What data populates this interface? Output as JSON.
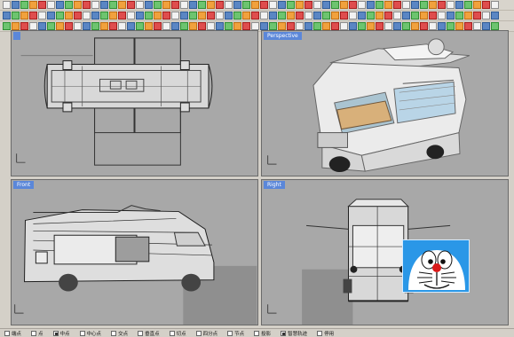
{
  "viewports": {
    "top_left_label": "",
    "perspective_label": "Perspective",
    "front_label": "Front",
    "right_label": "Right"
  },
  "status": {
    "items": [
      {
        "label": "端点",
        "checked": false
      },
      {
        "label": "点",
        "checked": false
      },
      {
        "label": "中点",
        "checked": true
      },
      {
        "label": "中心点",
        "checked": false
      },
      {
        "label": "交点",
        "checked": false
      },
      {
        "label": "垂直点",
        "checked": false
      },
      {
        "label": "切点",
        "checked": false
      },
      {
        "label": "四分点",
        "checked": false
      },
      {
        "label": "节点",
        "checked": false
      },
      {
        "label": "投影",
        "checked": false
      },
      {
        "label": "智慧轨迹",
        "checked": true
      },
      {
        "label": "停用",
        "checked": false
      }
    ]
  },
  "colors": {
    "viewport_bg": "#a8a8a8",
    "active_label": "#5b87d9",
    "sticker_blue": "#2a97e7"
  },
  "icons": {
    "toolbar": [
      "new-file-icon",
      "open-icon",
      "save-icon",
      "print-icon",
      "cut-icon",
      "copy-icon",
      "paste-icon",
      "undo-icon",
      "redo-icon",
      "pan-icon",
      "rotate-icon",
      "zoom-icon",
      "zoom-window-icon",
      "zoom-extents-icon",
      "select-icon",
      "layer-icon",
      "material-icon",
      "render-icon",
      "light-icon",
      "camera-icon",
      "grid-icon",
      "snap-icon",
      "measure-icon",
      "circle-icon",
      "rectangle-icon",
      "polyline-icon",
      "arc-icon",
      "curve-icon",
      "surface-icon",
      "box-icon",
      "sphere-icon",
      "cylinder-icon",
      "boolean-icon",
      "fillet-icon",
      "trim-icon",
      "split-icon",
      "join-icon",
      "explode-icon",
      "mirror-icon",
      "array-icon",
      "scale-icon",
      "move-icon",
      "rotate-3d-icon",
      "help-icon"
    ]
  }
}
